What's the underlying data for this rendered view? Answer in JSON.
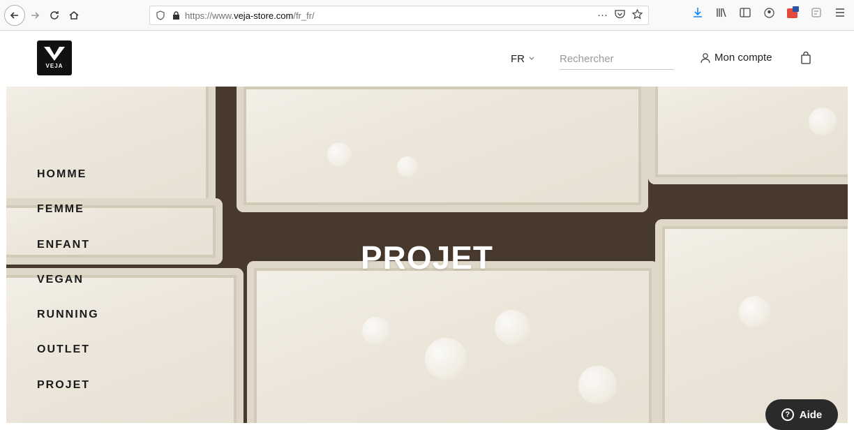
{
  "browser": {
    "url_prefix": "https://www.",
    "url_domain": "veja-store.com",
    "url_path": "/fr_fr/",
    "more_label": "···"
  },
  "header": {
    "logo_text": "VEJA",
    "language": "FR",
    "search_placeholder": "Rechercher",
    "account_label": "Mon compte"
  },
  "nav": {
    "items": [
      {
        "label": "HOMME"
      },
      {
        "label": "FEMME"
      },
      {
        "label": "ENFANT"
      },
      {
        "label": "VEGAN"
      },
      {
        "label": "RUNNING"
      },
      {
        "label": "OUTLET"
      },
      {
        "label": "PROJET"
      }
    ]
  },
  "hero": {
    "title": "PROJET"
  },
  "help": {
    "label": "Aide",
    "icon": "?"
  },
  "colors": {
    "accent": "#111111",
    "help_bg": "#2a2a2a"
  }
}
